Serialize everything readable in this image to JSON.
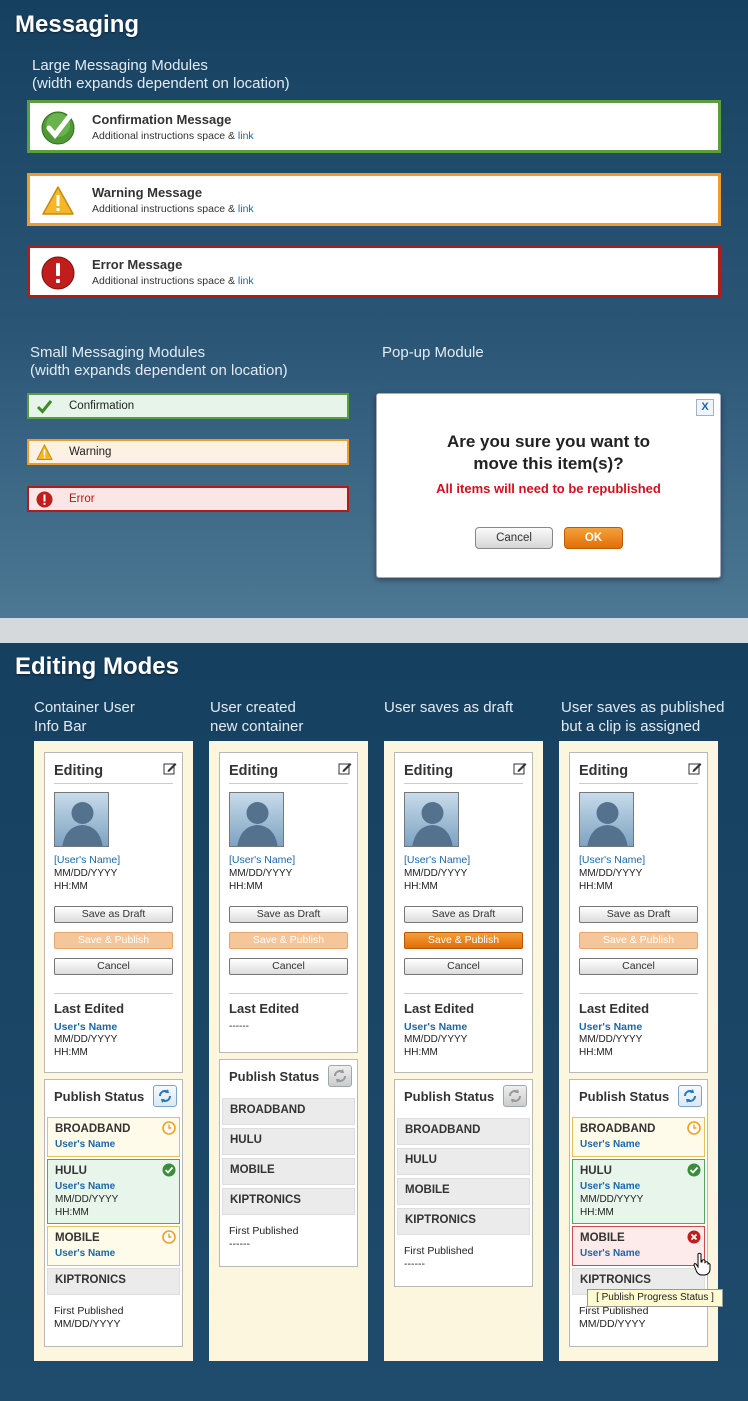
{
  "messaging": {
    "title": "Messaging",
    "large_heading_1": "Large Messaging Modules",
    "large_heading_2": "(width expands dependent on location)",
    "large": [
      {
        "title": "Confirmation Message",
        "desc": "Additional instructions space & ",
        "link": "link",
        "color": "#5b9e3f"
      },
      {
        "title": "Warning Message",
        "desc": "Additional instructions space & ",
        "link": "link",
        "color": "#ef9a2d"
      },
      {
        "title": "Error Message",
        "desc": "Additional instructions space & ",
        "link": "link",
        "color": "#b01c1c"
      }
    ],
    "small_heading_1": "Small Messaging Modules",
    "small_heading_2": "(width expands dependent on location)",
    "small": [
      {
        "label": "Confirmation",
        "color": "#5b9e3f",
        "bg": "#e6f4ea"
      },
      {
        "label": "Warning",
        "color": "#ef9a2d",
        "bg": "#fdf1e3"
      },
      {
        "label": "Error",
        "color": "#b01c1c",
        "bg": "#fbe6e6"
      }
    ],
    "popup_heading": "Pop-up Module",
    "popup": {
      "close": "X",
      "question_1": "Are you sure you want to",
      "question_2": "move this item(s)?",
      "warning": "All items will need to be republished",
      "cancel": "Cancel",
      "ok": "OK"
    }
  },
  "editing": {
    "title": "Editing Modes",
    "columns": [
      {
        "h1": "Container User",
        "h2": "Info Bar"
      },
      {
        "h1": "User created",
        "h2": "new container"
      },
      {
        "h1": "User saves as draft",
        "h2": ""
      },
      {
        "h1": "User saves as published",
        "h2": "but a clip is assigned"
      }
    ],
    "card": {
      "editing": "Editing",
      "user_name": "[User's Name]",
      "date": "MM/DD/YYYY",
      "time": "HH:MM",
      "save_draft": "Save as Draft",
      "save_publish": "Save & Publish",
      "cancel": "Cancel",
      "last_edited": "Last Edited",
      "le_user": "User's Name",
      "le_dashes": "------",
      "publish_status": "Publish Status",
      "first_published": "First Published",
      "fp_dashes": "------",
      "channels": [
        "BROADBAND",
        "HULU",
        "MOBILE",
        "KIPTRONICS"
      ],
      "ch_user": "User's Name"
    },
    "tooltip": "[ Publish Progress Status ]"
  }
}
